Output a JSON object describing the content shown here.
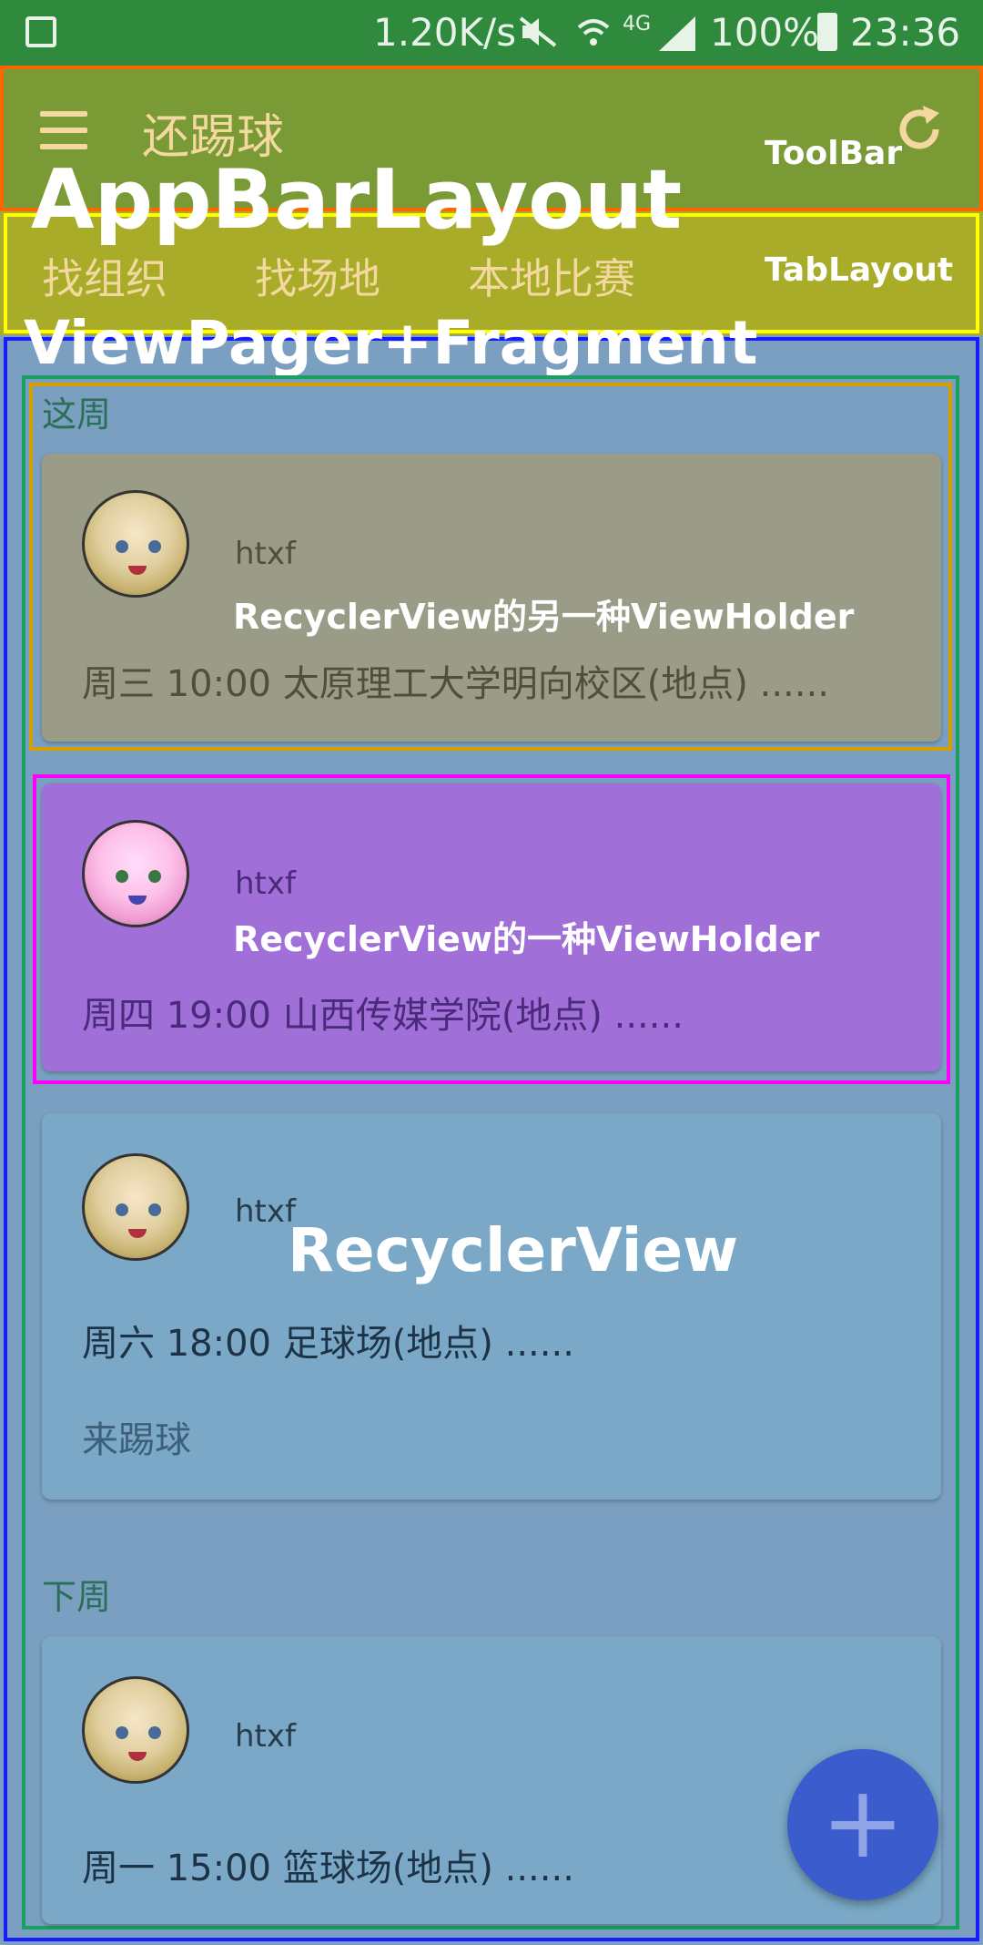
{
  "status_bar": {
    "speed": "1.20K/s",
    "network": "4G",
    "battery": "100%",
    "time": "23:36"
  },
  "toolbar": {
    "title": "还踢球",
    "menu_icon": "hamburger-menu-icon",
    "refresh_icon": "refresh-icon"
  },
  "tabs": [
    "找组织",
    "找场地",
    "本地比赛"
  ],
  "annotations": {
    "toolbar": "ToolBar",
    "appbar": "AppBarLayout",
    "tablayout": "TabLayout",
    "viewpager": "ViewPager+Fragment",
    "holder_alt": "RecyclerView的另一种ViewHolder",
    "holder": "RecyclerView的一种ViewHolder",
    "recycler": "RecyclerView"
  },
  "sections": {
    "this_week": "这周",
    "next_week": "下周"
  },
  "cards": [
    {
      "user": "htxf",
      "info": "周三 10:00 太原理工大学明向校区(地点) ......"
    },
    {
      "user": "htxf",
      "info": "周四 19:00 山西传媒学院(地点) ......"
    },
    {
      "user": "htxf",
      "info": "周六 18:00 足球场(地点) ......",
      "action": "来踢球"
    },
    {
      "user": "htxf",
      "info": "周一 15:00 篮球场(地点) ......"
    }
  ],
  "fab": {
    "icon": "add-icon",
    "label": "+"
  },
  "colors": {
    "status_bar": "#2f8a3e",
    "toolbar": "#7a9a35",
    "tab_strip": "#a8ac28",
    "accent": "#3a5ccc",
    "toolbar_outline": "#ff6600",
    "tab_outline": "#ffff00",
    "viewpager_outline": "#1a1aff",
    "recycler_outline": "#1aa060",
    "holder_alt_outline": "#d4a000",
    "holder_outline": "#ff00ff"
  }
}
